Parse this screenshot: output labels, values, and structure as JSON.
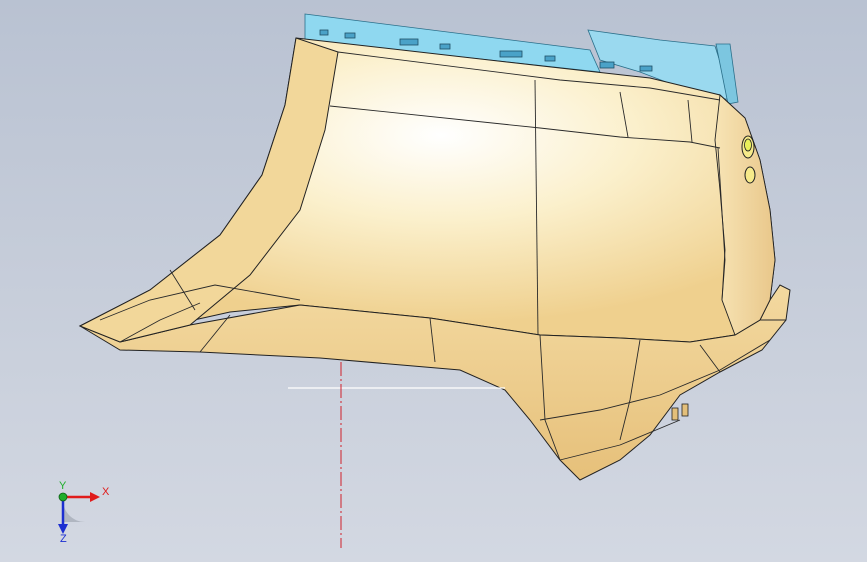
{
  "viewport": {
    "background_top": "#b9c2d2",
    "background_bottom": "#d3d8e2"
  },
  "model": {
    "body_color": "#f3dca0",
    "highlight_color": "#ffffff",
    "shadow_color": "#d9b56a",
    "edge_color": "#1f1f1f",
    "frame_color": "#8fd8f0",
    "sensor_color": "#e9ef5a"
  },
  "reference_lines": {
    "horizontal_color": "#ffffff",
    "vertical_color": "#d0202a"
  },
  "triad": {
    "x_label": "X",
    "y_label": "Y",
    "z_label": "Z",
    "x_color": "#e01b1b",
    "y_color": "#1fae2b",
    "z_color": "#1c2fd1"
  }
}
